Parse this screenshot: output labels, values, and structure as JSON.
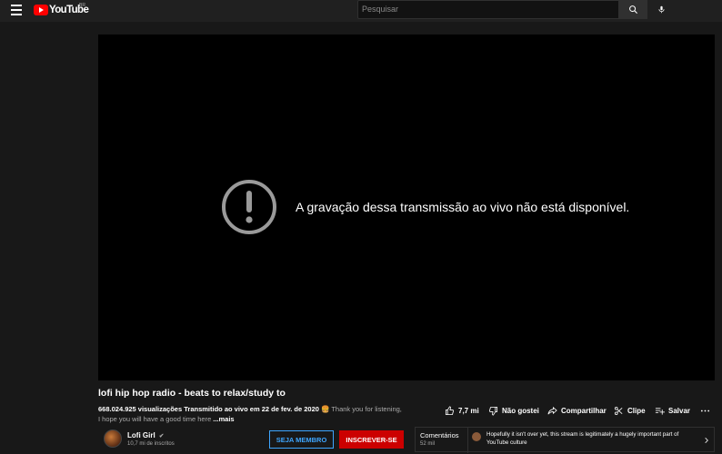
{
  "header": {
    "logo_text": "YouTube",
    "country_code": "BR",
    "search_placeholder": "Pesquisar"
  },
  "player": {
    "error_message": "A gravação dessa transmissão ao vivo não está disponível."
  },
  "video": {
    "title": "lofi hip hop radio - beats to relax/study to",
    "views": "668.024.925 visualizações",
    "streamed": "Transmitido ao vivo em 22 de fev. de 2020",
    "emoji": "🍔",
    "desc_line1": "Thank you for listening,",
    "desc_line2": "I hope you will have a good time here",
    "more_label": "...mais"
  },
  "actions": {
    "like_count": "7,7 mi",
    "dislike_label": "Não gostei",
    "share_label": "Compartilhar",
    "clip_label": "Clipe",
    "save_label": "Salvar"
  },
  "channel": {
    "name": "Lofi Girl",
    "verified_mark": "✔",
    "subscribers": "10,7 mi de inscritos",
    "member_button": "SEJA MEMBRO",
    "subscribe_button": "INSCREVER-SE"
  },
  "comments": {
    "label": "Comentários",
    "count": "52 mil",
    "top_comment": "Hopefully it isn't over yet, this stream is legitimately a hugely important part of YouTube culture"
  },
  "colors": {
    "brand_red": "#ff0000",
    "subscribe_red": "#cc0000",
    "member_blue": "#3ea6ff",
    "background": "#181818"
  },
  "icons": [
    "menu-icon",
    "youtube-logo-icon",
    "search-icon",
    "mic-icon",
    "error-icon",
    "like-icon",
    "dislike-icon",
    "share-icon",
    "clip-icon",
    "save-icon",
    "more-icon",
    "verified-icon",
    "chevron-right-icon"
  ]
}
